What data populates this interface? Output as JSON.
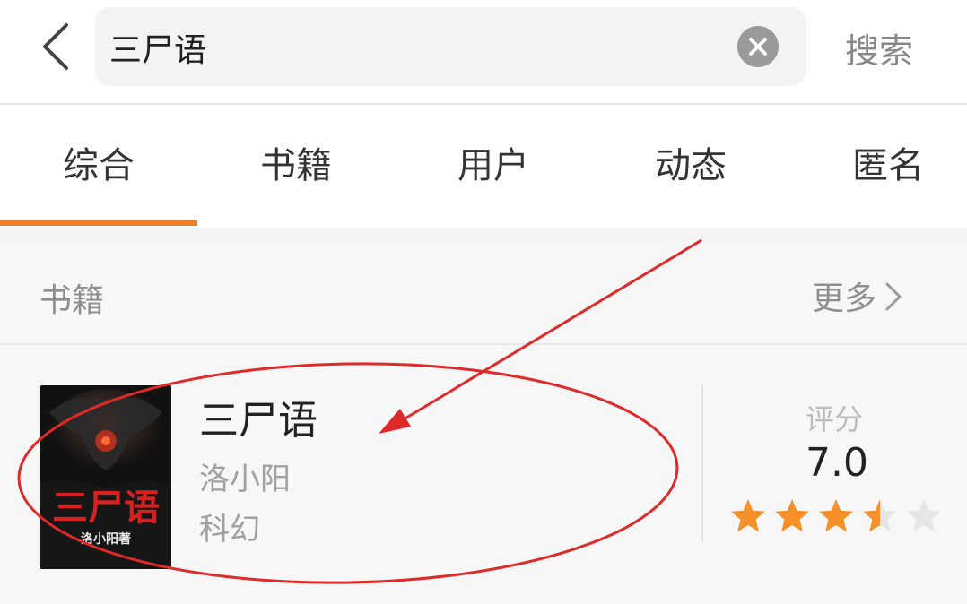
{
  "search": {
    "query": "三尸语",
    "submit_label": "搜索"
  },
  "tabs": [
    {
      "label": "综合",
      "active": true
    },
    {
      "label": "书籍",
      "active": false
    },
    {
      "label": "用户",
      "active": false
    },
    {
      "label": "动态",
      "active": false
    },
    {
      "label": "匿名",
      "active": false
    }
  ],
  "section": {
    "title": "书籍",
    "more_label": "更多"
  },
  "book": {
    "title": "三尸语",
    "author": "洛小阳",
    "genre": "科幻",
    "rating_label": "评分",
    "rating": "7.0",
    "stars_filled": 3.5,
    "stars_total": 5,
    "cover": {
      "title": "三尸语",
      "author_tag": "洛小阳著"
    }
  },
  "colors": {
    "accent": "#f07f28",
    "star_filled": "#f5902a",
    "star_empty": "#e6e6e6",
    "annotation": "#e02a2a"
  }
}
